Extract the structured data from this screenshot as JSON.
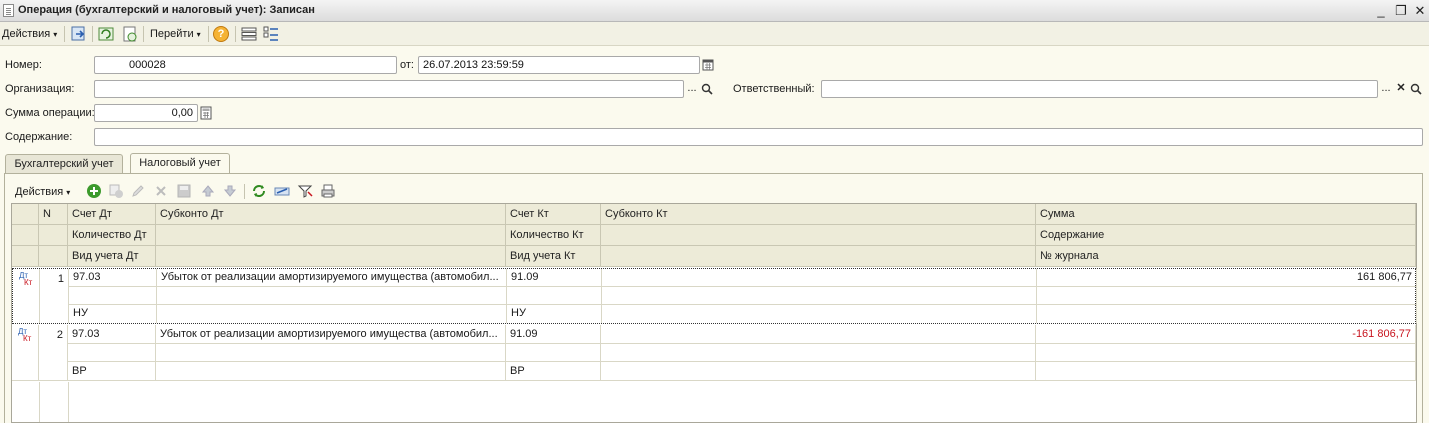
{
  "window": {
    "title": "Операция (бухгалтерский и налоговый учет): Записан",
    "minimize": "_",
    "restore": "❐",
    "close": "✕"
  },
  "toolbar": {
    "actions_label": "Действия",
    "goto_label": "Перейти",
    "help_glyph": "?"
  },
  "form": {
    "number_label": "Номер:",
    "number_value": "000028",
    "date_label": "от:",
    "date_value": "26.07.2013 23:59:59",
    "org_label": "Организация:",
    "org_value": "",
    "responsible_label": "Ответственный:",
    "responsible_value": "",
    "sum_label": "Сумма операции:",
    "sum_value": "0,00",
    "content_label": "Содержание:",
    "content_value": "",
    "ellipsis": "...",
    "clear_glyph": "✕"
  },
  "tabs": [
    {
      "label": "Бухгалтерский учет"
    },
    {
      "label": "Налоговый учет"
    }
  ],
  "table_toolbar": {
    "actions_label": "Действия"
  },
  "table": {
    "headers": {
      "n": "N",
      "acc_dt": "Счет Дт",
      "sub_dt": "Субконто Дт",
      "acc_kt": "Счет Кт",
      "sub_kt": "Субконто Кт",
      "sum": "Сумма",
      "qty_dt": "Количество Дт",
      "qty_kt": "Количество Кт",
      "content": "Содержание",
      "type_dt": "Вид учета Дт",
      "type_kt": "Вид учета Кт",
      "journal": "№ журнала"
    },
    "rows": [
      {
        "n": "1",
        "acc_dt": "97.03",
        "sub_dt": "Убыток от реализации амортизируемого имущества (автомобил...",
        "acc_kt": "91.09",
        "sum": "161 806,77",
        "type_dt": "НУ",
        "type_kt": "НУ",
        "icon_a": "Дт",
        "icon_b": "Кт"
      },
      {
        "n": "2",
        "acc_dt": "97.03",
        "sub_dt": "Убыток от реализации амортизируемого имущества (автомобил...",
        "acc_kt": "91.09",
        "sum": "-161 806,77",
        "type_dt": "ВР",
        "type_kt": "ВР",
        "icon_a": "Дт",
        "icon_b": "Кт"
      }
    ]
  },
  "colors": {
    "negative": "#c8141e",
    "accent_blue": "#2a5fb0",
    "background": "#fbfaee"
  }
}
